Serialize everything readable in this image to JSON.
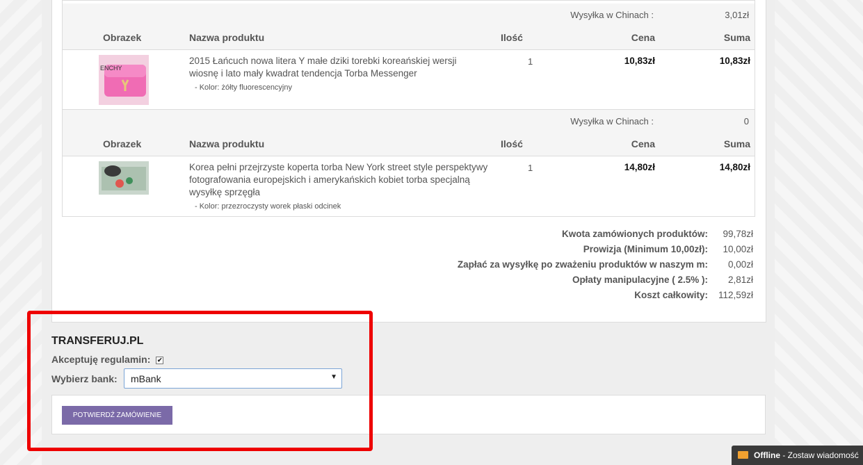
{
  "table_headers": {
    "image": "Obrazek",
    "name": "Nazwa produktu",
    "qty": "Ilość",
    "price": "Cena",
    "sum": "Suma"
  },
  "shipments": [
    {
      "ship_label": "Wysyłka w Chinach :",
      "ship_value": "3,01zł",
      "product": {
        "name": "2015 Łańcuch nowa litera Y małe dziki torebki koreańskiej wersji wiosnę i lato mały kwadrat tendencja Torba Messenger",
        "variant": "- Kolor: żółty fluorescencyjny",
        "qty": "1",
        "price": "10,83zł",
        "sum": "10,83zł",
        "image_colors": {
          "bg": "#f06cb4",
          "accent": "#e8c77a"
        }
      }
    },
    {
      "ship_label": "Wysyłka w Chinach :",
      "ship_value": "0",
      "product": {
        "name": "Korea pełni przejrzyste koperta torba New York street style perspektywy fotografowania europejskich i amerykańskich kobiet torba specjalną wysyłkę sprzęgła",
        "variant": "- Kolor: przezroczysty worek płaski odcinek",
        "qty": "1",
        "price": "14,80zł",
        "sum": "14,80zł",
        "image_colors": {
          "bg": "#9fb8a4",
          "accent": "#3a3a3a"
        }
      }
    }
  ],
  "totals": [
    {
      "label": "Kwota zamówionych produktów:",
      "value": "99,78zł"
    },
    {
      "label": "Prowizja (Minimum 10,00zł):",
      "value": "10,00zł"
    },
    {
      "label": "Zapłać za wysyłkę po zważeniu produktów w naszym m:",
      "value": "0,00zł"
    },
    {
      "label": "Opłaty manipulacyjne ( 2.5% ):",
      "value": "2,81zł"
    },
    {
      "label": "Koszt całkowity:",
      "value": "112,59zł"
    }
  ],
  "payment": {
    "title": "TRANSFERUJ.PL",
    "accept_label": "Akceptuję regulamin:",
    "accept_checked": true,
    "bank_label": "Wybierz bank:",
    "bank_selected": "mBank",
    "confirm_button": "POTWIERDŹ ZAMÓWIENIE"
  },
  "chat": {
    "status": "Offline",
    "message": " - Zostaw wiadomość"
  },
  "colors": {
    "button": "#7b6aa8",
    "highlight": "#ee0000",
    "chat_bg": "#3a3a3a"
  }
}
